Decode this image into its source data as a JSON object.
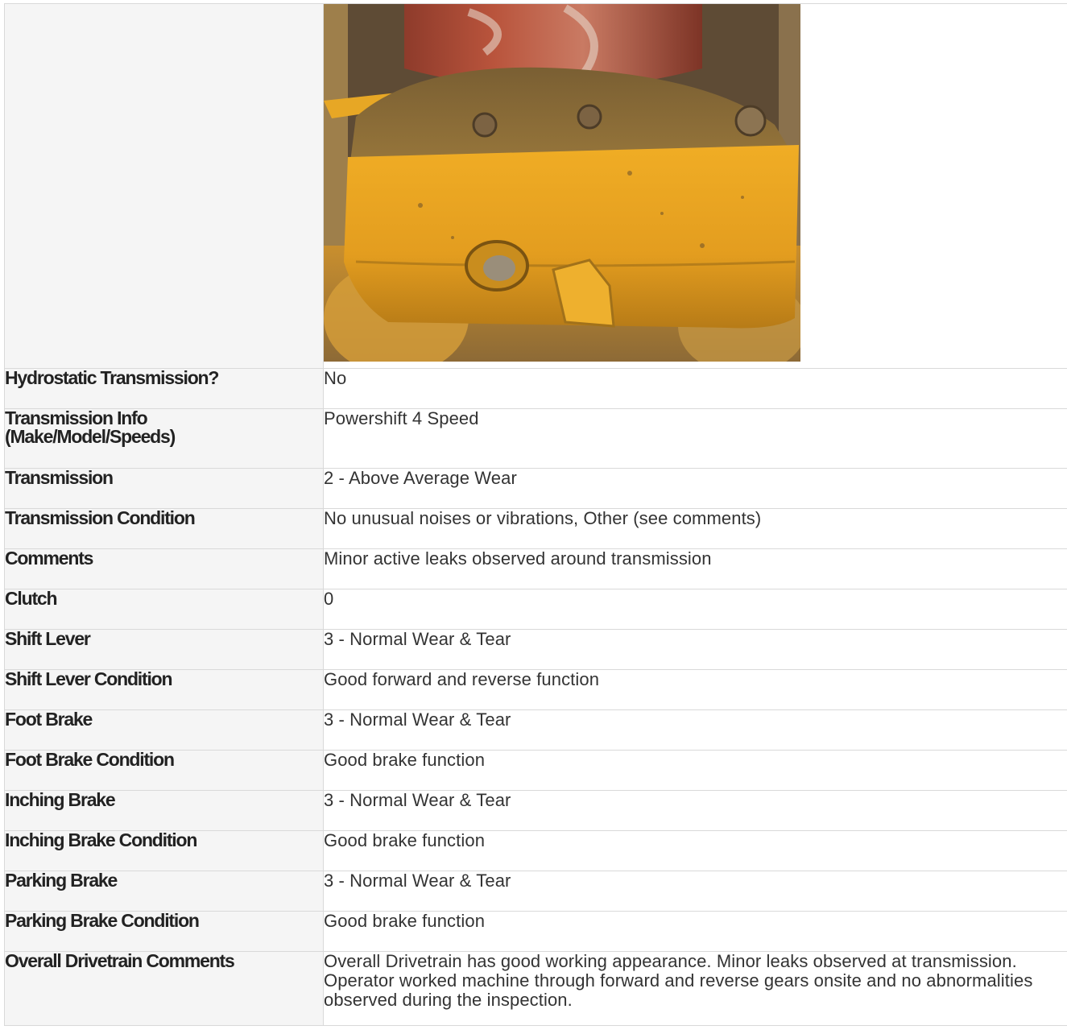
{
  "rows": [
    {
      "label": "Hydrostatic Transmission?",
      "value": "No"
    },
    {
      "label": "Transmission Info (Make/Model/Speeds)",
      "value": "Powershift 4 Speed"
    },
    {
      "label": "Transmission",
      "value": "2 - Above Average Wear"
    },
    {
      "label": "Transmission Condition",
      "value": "No unusual noises or vibrations, Other (see comments)"
    },
    {
      "label": "Comments",
      "value": "Minor active leaks observed around transmission"
    },
    {
      "label": "Clutch",
      "value": "0"
    },
    {
      "label": "Shift Lever",
      "value": "3 - Normal Wear & Tear"
    },
    {
      "label": "Shift Lever Condition",
      "value": "Good forward and reverse function"
    },
    {
      "label": "Foot Brake",
      "value": "3 - Normal Wear & Tear"
    },
    {
      "label": "Foot Brake Condition",
      "value": "Good brake function"
    },
    {
      "label": "Inching Brake",
      "value": "3 - Normal Wear & Tear"
    },
    {
      "label": "Inching Brake Condition",
      "value": "Good brake function"
    },
    {
      "label": "Parking Brake",
      "value": "3 - Normal Wear & Tear"
    },
    {
      "label": "Parking Brake Condition",
      "value": "Good brake function"
    },
    {
      "label": "Overall Drivetrain Comments",
      "value": "Overall Drivetrain has good working appearance. Minor leaks observed at transmission. Operator worked machine through forward and reverse gears onsite and no abnormalities observed during the inspection."
    }
  ],
  "colors": {
    "label_bg": "#f5f5f5",
    "border": "#d9d9d9",
    "machine_yellow": "#e3a021",
    "drum_red": "#b5503a"
  }
}
